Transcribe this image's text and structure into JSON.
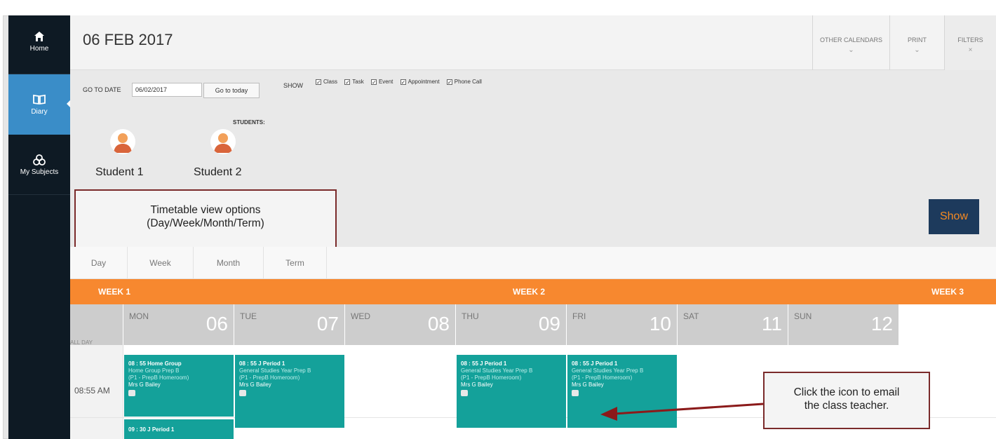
{
  "header": {
    "date_title": "06 FEB 2017",
    "other_calendars": "OTHER CALENDARS",
    "print": "PRINT",
    "filters": "FILTERS"
  },
  "sidebar": {
    "items": [
      {
        "label": "Home",
        "icon": "home-icon"
      },
      {
        "label": "Diary",
        "icon": "book-icon"
      },
      {
        "label": "My Subjects",
        "icon": "subjects-icon"
      }
    ]
  },
  "filters": {
    "go_to_date_label": "GO TO DATE",
    "date_value": "06/02/2017",
    "go_to_today": "Go to today",
    "show_label": "SHOW",
    "show_options": [
      "Class",
      "Task",
      "Event",
      "Appointment",
      "Phone Call"
    ],
    "students_label": "STUDENTS:",
    "students": [
      "Student 1",
      "Student 2"
    ],
    "show_button": "Show"
  },
  "callouts": {
    "view_options_line1": "Timetable view options",
    "view_options_line2": "(Day/Week/Month/Term)",
    "email_line1": "Click the icon to email",
    "email_line2": "the class teacher."
  },
  "tabs": [
    "Day",
    "Week",
    "Month",
    "Term"
  ],
  "weeks": [
    "WEEK 1",
    "WEEK 2",
    "WEEK 3"
  ],
  "days": [
    {
      "name": "MON",
      "num": "06"
    },
    {
      "name": "TUE",
      "num": "07"
    },
    {
      "name": "WED",
      "num": "08"
    },
    {
      "name": "THU",
      "num": "09"
    },
    {
      "name": "FRI",
      "num": "10"
    },
    {
      "name": "SAT",
      "num": "11"
    },
    {
      "name": "SUN",
      "num": "12"
    }
  ],
  "grid": {
    "all_day_label": "ALL DAY",
    "time_label": "08:55 AM"
  },
  "events": [
    {
      "time": "08 : 55",
      "title": "Home Group",
      "line1": "Home Group Prep B",
      "line2": "(P1 - PrepB Homeroom)",
      "teacher": "Mrs G Bailey"
    },
    {
      "time": "08 : 55",
      "title": "J Period 1",
      "line1": "General Studies Year Prep B",
      "line2": "(P1 - PrepB Homeroom)",
      "teacher": "Mrs G Bailey"
    },
    {
      "time": "08 : 55",
      "title": "J Period 1",
      "line1": "General Studies Year Prep B",
      "line2": "(P1 - PrepB Homeroom)",
      "teacher": "Mrs G Bailey"
    },
    {
      "time": "08 : 55",
      "title": "J Period 1",
      "line1": "General Studies Year Prep B",
      "line2": "(P1 - PrepB Homeroom)",
      "teacher": "Mrs G Bailey"
    },
    {
      "time": "09 : 30",
      "title": "J Period 1"
    }
  ],
  "colors": {
    "sidebar": "#0e1a24",
    "sidebar_active": "#3a8dc8",
    "week_bar": "#f7882f",
    "event": "#14a19a",
    "show_button": "#1d3a5c",
    "callout_border": "#7a2a2a"
  }
}
